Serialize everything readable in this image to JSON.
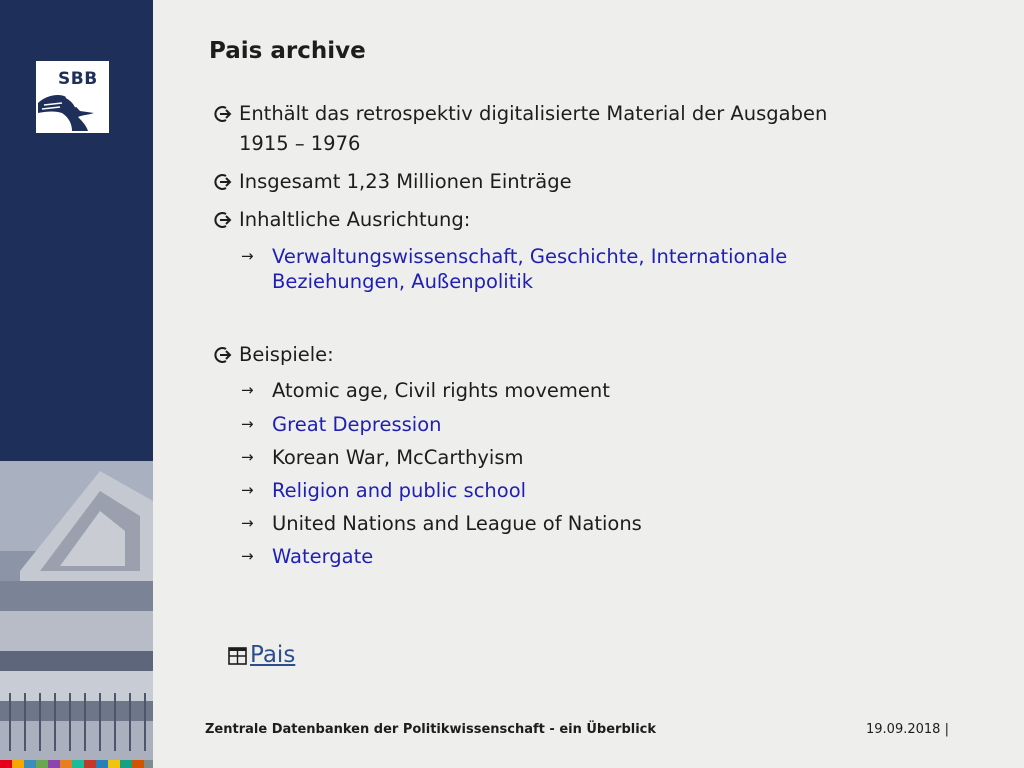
{
  "logo": {
    "text": "SBB"
  },
  "title": "Pais archive",
  "bullets": [
    {
      "lines": [
        "Enthält das retrospektiv digitalisierte Material der Ausgaben",
        "1915 – 1976"
      ]
    },
    {
      "lines": [
        "Insgesamt 1,23 Millionen Einträge"
      ]
    },
    {
      "lines": [
        "Inhaltliche Ausrichtung:"
      ]
    }
  ],
  "focus_subitem": {
    "lines": [
      "Verwaltungswissenschaft, Geschichte, Internationale",
      "Beziehungen, Außenpolitik"
    ]
  },
  "examples_label": "Beispiele:",
  "examples": [
    "Atomic age, Civil rights movement",
    "Great Depression",
    "Korean War, McCarthyism",
    "Religion and public school",
    "United Nations and League of Nations",
    "Watergate"
  ],
  "link": {
    "label": "Pais"
  },
  "footer": {
    "text": "Zentrale Datenbanken der Politikwissenschaft - ein Überblick",
    "date": "19.09.2018 |"
  },
  "colors": {
    "sidebar": "#1e2f59",
    "link_blue": "#1f1fb4",
    "background": "#eeeeec"
  },
  "icons": {
    "bullet": "circled-arrow-icon",
    "sub_bullet": "arrow-right-icon",
    "link_icon": "window-icon"
  }
}
